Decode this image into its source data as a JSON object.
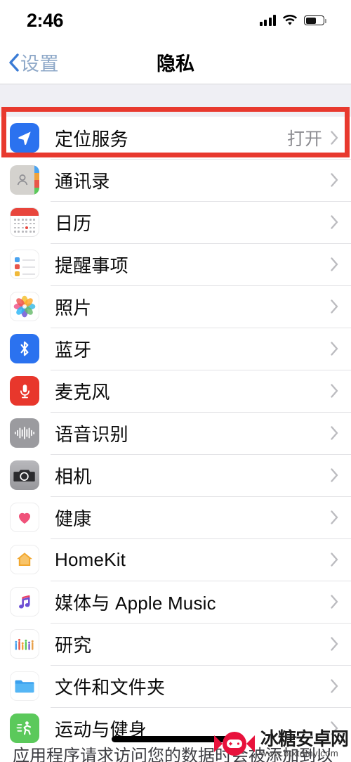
{
  "status_bar": {
    "time": "2:46",
    "signal_icon": "cellular-signal-icon",
    "wifi_icon": "wifi-icon",
    "battery_icon": "battery-icon",
    "battery_level_percent": 62
  },
  "nav_bar": {
    "back_label": "设置",
    "back_icon": "chevron-left-icon",
    "title": "隐私"
  },
  "annotation": {
    "color": "#e8392e",
    "target_row": "定位服务"
  },
  "list": {
    "rows": [
      {
        "label": "定位服务",
        "value": "打开",
        "icon": "location-arrow-icon"
      },
      {
        "label": "通讯录",
        "value": "",
        "icon": "contacts-icon"
      },
      {
        "label": "日历",
        "value": "",
        "icon": "calendar-icon"
      },
      {
        "label": "提醒事项",
        "value": "",
        "icon": "reminders-icon"
      },
      {
        "label": "照片",
        "value": "",
        "icon": "photos-icon"
      },
      {
        "label": "蓝牙",
        "value": "",
        "icon": "bluetooth-icon"
      },
      {
        "label": "麦克风",
        "value": "",
        "icon": "microphone-icon"
      },
      {
        "label": "语音识别",
        "value": "",
        "icon": "speech-waveform-icon"
      },
      {
        "label": "相机",
        "value": "",
        "icon": "camera-icon"
      },
      {
        "label": "健康",
        "value": "",
        "icon": "health-heart-icon"
      },
      {
        "label": "HomeKit",
        "value": "",
        "icon": "home-icon"
      },
      {
        "label": "媒体与 Apple Music",
        "value": "",
        "icon": "music-note-icon"
      },
      {
        "label": "研究",
        "value": "",
        "icon": "research-chart-icon"
      },
      {
        "label": "文件和文件夹",
        "value": "",
        "icon": "folder-icon"
      },
      {
        "label": "运动与健身",
        "value": "",
        "icon": "running-person-icon"
      }
    ],
    "chevron_icon": "chevron-right-icon"
  },
  "footer": {
    "text": "应用程序请求访问您的数据时会被添加到以"
  },
  "watermark": {
    "title": "冰糖安卓网",
    "url": "www.btxtdmy.com",
    "logo_icon": "candy-gamepad-logo-icon"
  },
  "colors": {
    "accent_blue": "#007aff",
    "annotation_red": "#e8392e",
    "group_background": "#efeff4",
    "separator": "#e2e2e5"
  }
}
